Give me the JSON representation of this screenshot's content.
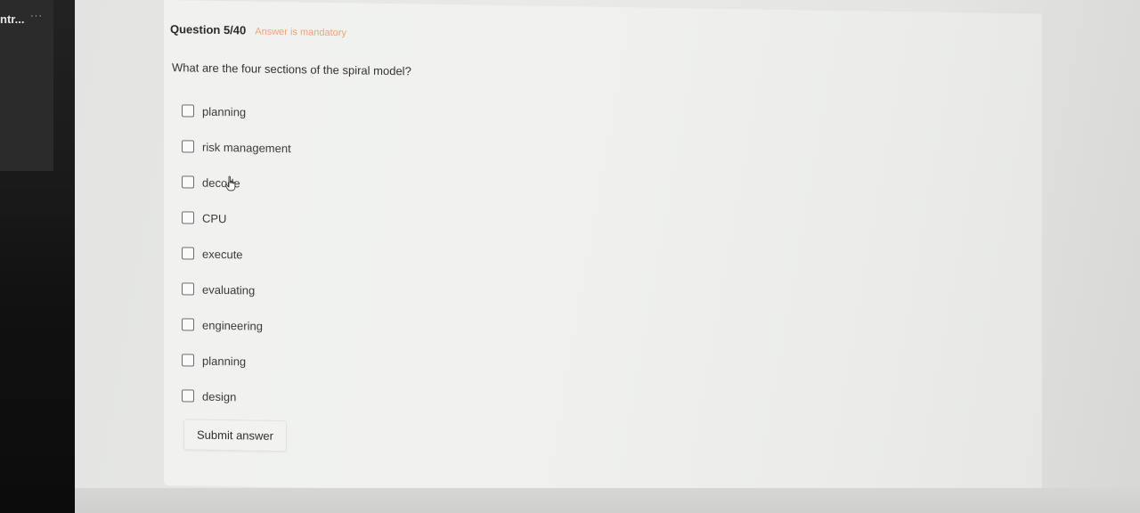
{
  "sidebar": {
    "app_name": "ntr...",
    "more": "···"
  },
  "question": {
    "number_label": "Question 5/40",
    "mandatory_label": "Answer is mandatory",
    "text": "What are the four sections of the spiral model?"
  },
  "options": [
    {
      "label": "planning",
      "checked": false
    },
    {
      "label": "risk management",
      "checked": false
    },
    {
      "label": "decode",
      "checked": false
    },
    {
      "label": "CPU",
      "checked": false
    },
    {
      "label": "execute",
      "checked": false
    },
    {
      "label": "evaluating",
      "checked": false
    },
    {
      "label": "engineering",
      "checked": false
    },
    {
      "label": "planning",
      "checked": false
    },
    {
      "label": "design",
      "checked": false
    }
  ],
  "submit_label": "Submit answer",
  "icons": {
    "checkbox": "checkbox-icon",
    "cursor": "hand-pointer-icon"
  },
  "colors": {
    "mandatory": "#f0a272",
    "text": "#333333",
    "card": "#f0f1ef"
  }
}
